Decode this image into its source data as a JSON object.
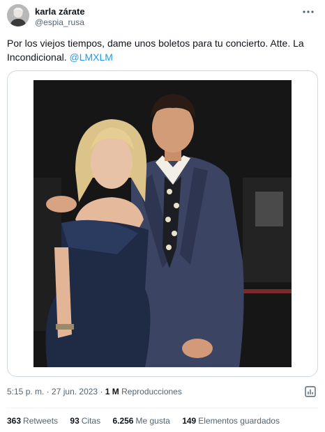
{
  "tweet": {
    "author": {
      "display_name": "karla zárate",
      "handle": "@espia_rusa",
      "avatar_icon": "user-avatar"
    },
    "more_icon": "more-dots-icon",
    "text_main": "Por los viejos tiempos, dame unos boletos para tu concierto. Atte. La Incondicional. ",
    "mention": "@LMXLM",
    "time": "5:15 p. m.",
    "separator1": " · ",
    "date": "27 jun. 2023",
    "separator2": " · ",
    "views_count": "1 M",
    "views_label": "Reproducciones",
    "analytics_icon": "analytics-icon",
    "stats": [
      {
        "count": "363",
        "label": "Retweets"
      },
      {
        "count": "93",
        "label": "Citas"
      },
      {
        "count": "6.256",
        "label": "Me gusta"
      },
      {
        "count": "149",
        "label": "Elementos guardados"
      }
    ]
  },
  "colors": {
    "text": "#0f1419",
    "secondary": "#536471",
    "link": "#1d9bf0",
    "border": "#cfd9de"
  }
}
